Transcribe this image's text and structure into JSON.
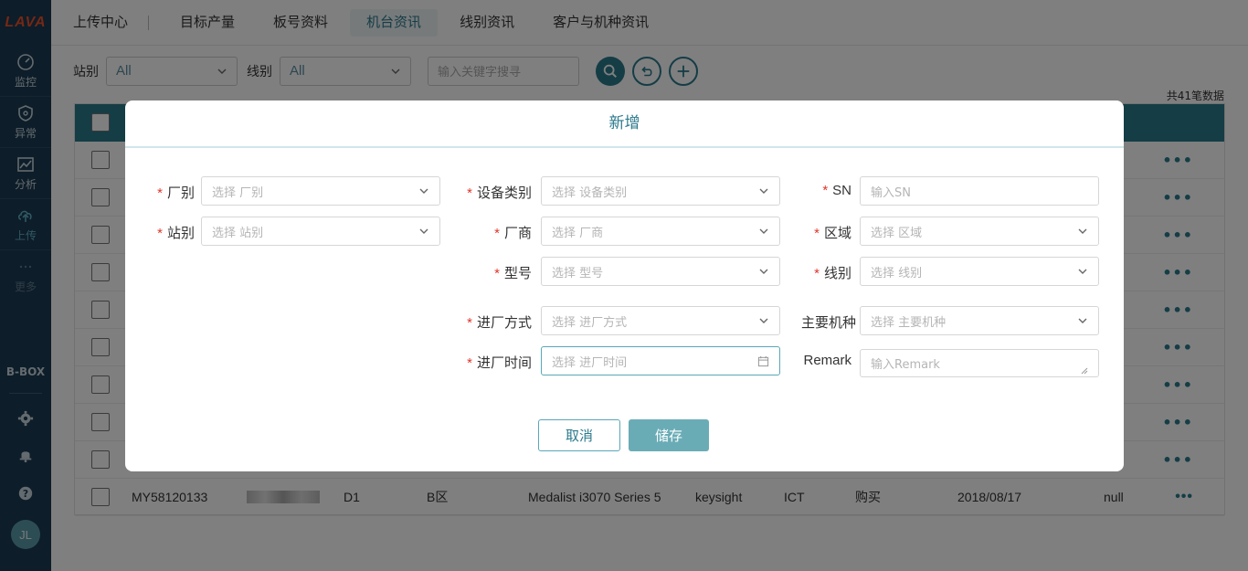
{
  "brand": {
    "logo_text": "LAVA"
  },
  "sidebar": {
    "items": [
      {
        "label": "监控",
        "icon": "dashboard-icon"
      },
      {
        "label": "异常",
        "icon": "shield-icon"
      },
      {
        "label": "分析",
        "icon": "chart-icon"
      },
      {
        "label": "上传",
        "icon": "upload-cloud-icon"
      },
      {
        "label": "更多",
        "icon": "more-dots-icon"
      }
    ],
    "bbox_label": "B-BOX",
    "avatar": "JL"
  },
  "topnav": {
    "tabs": [
      "上传中心",
      "目标产量",
      "板号资料",
      "机台资讯",
      "线别资讯",
      "客户与机种资讯"
    ],
    "active": "机台资讯"
  },
  "filter": {
    "station_label": "站别",
    "station_value": "All",
    "line_label": "线别",
    "line_value": "All",
    "search_placeholder": "输入关键字搜寻"
  },
  "table": {
    "count_text": "共41笔数据",
    "visible_row": {
      "sn": "MY58120133",
      "station": "D1",
      "area": "B区",
      "model": "Medalist i3070 Series 5",
      "vendor": "keysight",
      "type": "ICT",
      "entry": "购买",
      "date": "2018/08/17",
      "remark": "null"
    },
    "action": "•••"
  },
  "modal": {
    "title": "新增",
    "fields": {
      "factory": {
        "label": "厂别",
        "placeholder": "选择 厂别"
      },
      "station": {
        "label": "站别",
        "placeholder": "选择 站别"
      },
      "device_type": {
        "label": "设备类别",
        "placeholder": "选择 设备类别"
      },
      "vendor": {
        "label": "厂商",
        "placeholder": "选择 厂商"
      },
      "model": {
        "label": "型号",
        "placeholder": "选择 型号"
      },
      "entry_method": {
        "label": "进厂方式",
        "placeholder": "选择 进厂方式"
      },
      "entry_time": {
        "label": "进厂时间",
        "placeholder": "选择 进厂时间"
      },
      "sn": {
        "label": "SN",
        "placeholder": "输入SN"
      },
      "region": {
        "label": "区域",
        "placeholder": "选择 区域"
      },
      "line": {
        "label": "线别",
        "placeholder": "选择 线别"
      },
      "main_product": {
        "label": "主要机种",
        "placeholder": "选择 主要机种"
      },
      "remark": {
        "label": "Remark",
        "placeholder": "输入Remark"
      }
    },
    "required_mark": "*",
    "cancel_label": "取消",
    "save_label": "储存"
  },
  "colors": {
    "accent": "#2b7a8c",
    "sidebar": "#1b3a52",
    "required": "#e0352b",
    "save": "#6aacb6"
  }
}
